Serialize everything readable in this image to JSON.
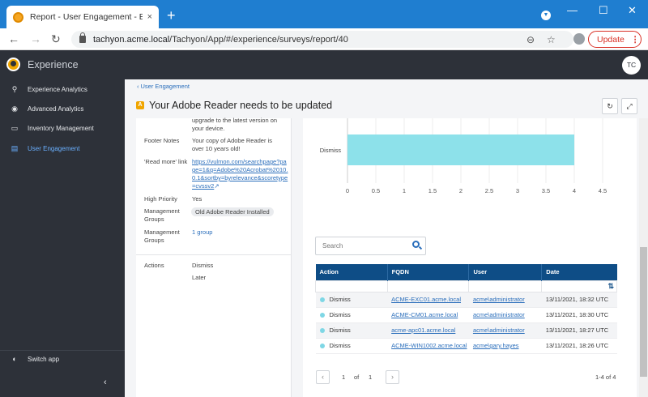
{
  "browser": {
    "tab_title": "Report - User Engagement - Exp",
    "tab_close": "×",
    "new_tab": "+",
    "url_host": "tachyon.acme.local",
    "url_path": "/Tachyon/App/#/experience/surveys/report/40",
    "update_label": "Update",
    "update_dots": "⋮",
    "window_controls": [
      "—",
      "☐",
      "✕"
    ]
  },
  "app": {
    "name": "Experience",
    "avatar_initials": "TC"
  },
  "sidebar": {
    "items": [
      {
        "label": "Experience Analytics",
        "icon": "person-search-icon"
      },
      {
        "label": "Advanced Analytics",
        "icon": "binoculars-icon"
      },
      {
        "label": "Inventory Management",
        "icon": "monitor-icon"
      },
      {
        "label": "User Engagement",
        "icon": "clipboard-icon",
        "active": true
      }
    ],
    "switch_app": "Switch app",
    "collapse": "‹"
  },
  "page": {
    "breadcrumb": "User Engagement",
    "title": "Your Adobe Reader needs to be updated",
    "title_icon_letter": "A"
  },
  "details": {
    "partial_text": "upgrade to the latest version on your device.",
    "footer_label": "Footer Notes",
    "footer_value": "Your copy of Adobe Reader is over 10 years old!",
    "readmore_label": "'Read more' link",
    "readmore_value": "https://vulmon.com/searchpage?page=1&q=Adobe%20Acrobat%2010.0.1&sortby=byrelevance&scoretype=cvssv2",
    "priority_label": "High Priority",
    "priority_value": "Yes",
    "mgmt_label": "Management Groups",
    "mgmt_chip": "Old Adobe Reader Installed",
    "mgmt2_label": "Management Groups",
    "mgmt2_value": "1 group",
    "actions_label": "Actions",
    "actions": [
      "Dismiss",
      "Later"
    ]
  },
  "chart_data": {
    "type": "bar",
    "orientation": "horizontal",
    "categories": [
      "Dismiss"
    ],
    "values": [
      4
    ],
    "xlim": [
      0,
      4.5
    ],
    "x_ticks": [
      "0",
      "0.5",
      "1",
      "1.5",
      "2",
      "2.5",
      "3",
      "3.5",
      "4",
      "4.5"
    ],
    "bar_color": "#8de1ea",
    "grid": true
  },
  "search": {
    "placeholder": "Search"
  },
  "table": {
    "columns": [
      "Action",
      "FQDN",
      "User",
      "Date"
    ],
    "rows": [
      {
        "action": "Dismiss",
        "fqdn": "ACME-EXC01.acme.local",
        "user": "acme\\administrator",
        "date": "13/11/2021, 18:32 UTC"
      },
      {
        "action": "Dismiss",
        "fqdn": "ACME-CM01.acme.local",
        "user": "acme\\administrator",
        "date": "13/11/2021, 18:30 UTC"
      },
      {
        "action": "Dismiss",
        "fqdn": "acme-apc01.acme.local",
        "user": "acme\\administrator",
        "date": "13/11/2021, 18:27 UTC"
      },
      {
        "action": "Dismiss",
        "fqdn": "ACME-WIN1002.acme.local",
        "user": "acme\\gary.hayes",
        "date": "13/11/2021, 18:26 UTC"
      }
    ],
    "sort_icon": "⇅"
  },
  "pagination": {
    "prev": "‹",
    "next": "›",
    "page": "1",
    "of": "of",
    "total_pages": "1",
    "range": "1-4 of 4"
  },
  "colors": {
    "sidebar_bg": "#2d3139",
    "accent": "#2a6ebb",
    "table_header": "#0e4d86",
    "browser_blue": "#1f7ed0",
    "bar": "#8de1ea"
  }
}
